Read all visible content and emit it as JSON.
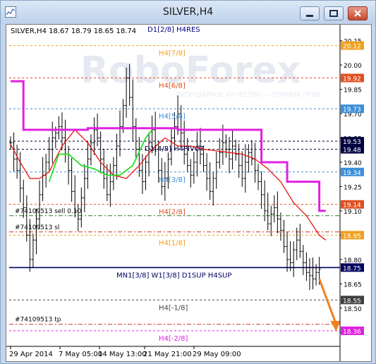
{
  "window": {
    "title": "SILVER,H4",
    "buttons": [
      "minimize",
      "restore",
      "close"
    ],
    "icon": "chart-window-icon"
  },
  "chart_data": {
    "type": "candlestick",
    "symbol_info": "SILVER,H4  18.67 18.79 18.65 18.74",
    "watermark": "RoboForex",
    "watermark_tagline": "ЛЕГЕНДАРНОЕ КАЧЕСТВО — ПОЛНЫЙ ПРИВ",
    "ylim": [
      18.29,
      20.24
    ],
    "price_ticks": [
      "20.15",
      "20.00",
      "19.85",
      "19.70",
      "19.55",
      "19.40",
      "19.25",
      "19.10",
      "18.95",
      "18.80",
      "18.65",
      "18.50",
      "18.35"
    ],
    "price_tick_values": [
      20.15,
      20.0,
      19.85,
      19.7,
      19.55,
      19.4,
      19.25,
      19.1,
      18.95,
      18.8,
      18.65,
      18.5,
      18.35
    ],
    "time_ticks": [
      "29 Apr 2014",
      "7 May 05:00",
      "14 May 13:00",
      "21 May 21:00",
      "29 May 09:00"
    ],
    "levels": [
      {
        "name": "D1[2/8] H4RES",
        "price": 20.25,
        "color": "#000080",
        "style": "none",
        "badge": ""
      },
      {
        "name": "H4[7/8]",
        "price": 20.12,
        "color": "#f0a020",
        "style": "dash",
        "badge": "20.12"
      },
      {
        "name": "H4[6/8]",
        "price": 19.92,
        "color": "#e05020",
        "style": "dash",
        "badge": "19.92"
      },
      {
        "name": "H4[5/8]",
        "price": 19.73,
        "color": "#3c8fd8",
        "style": "dash",
        "badge": "19.73"
      },
      {
        "name": "D1[4/8] H4PIVOT",
        "price": 19.53,
        "color": "#000040",
        "style": "dash",
        "badge": "19.53"
      },
      {
        "name": "",
        "price": 19.48,
        "color": "#000040",
        "style": "dash",
        "badge": "19.48"
      },
      {
        "name": "H4[3/8]",
        "price": 19.34,
        "color": "#3c8fd8",
        "style": "dash",
        "badge": "19.34"
      },
      {
        "name": "H4[2/8]",
        "price": 19.14,
        "color": "#e05020",
        "style": "dash",
        "badge": "19.14"
      },
      {
        "name": "H4[1/8]",
        "price": 18.95,
        "color": "#f0a020",
        "style": "dash",
        "badge": "18.95"
      },
      {
        "name": "MN1[3/8] W1[3/8] D1SUP H4SUP",
        "price": 18.75,
        "color": "#000060",
        "style": "solid",
        "badge": "18.75"
      },
      {
        "name": "H4[-1/8]",
        "price": 18.55,
        "color": "#444444",
        "style": "dash",
        "badge": "18.55"
      },
      {
        "name": "H4[-2/8]",
        "price": 18.36,
        "color": "#e020e0",
        "style": "dash",
        "badge": "18.36"
      }
    ],
    "orders": [
      {
        "label": "#74109513 sell 0.10",
        "price": 19.07,
        "color": "#208020"
      },
      {
        "label": "#74109513 sl",
        "price": 18.97,
        "color": "#d03020"
      },
      {
        "label": "#74109513 tp",
        "price": 18.4,
        "color": "#d03020"
      }
    ],
    "badge_colors": {
      "20.12": "#f0a020",
      "19.92": "#e05020",
      "19.73": "#3c8fd8",
      "19.53": "#000040",
      "19.48": "#000040",
      "19.34": "#3c8fd8",
      "19.14": "#e05020",
      "18.95": "#f0a020",
      "18.75": "#000060",
      "18.55": "#404040",
      "18.36": "#e020e0"
    },
    "magenta_line": [
      [
        0,
        19.9
      ],
      [
        4,
        19.9
      ],
      [
        4,
        19.6
      ],
      [
        24,
        19.6
      ],
      [
        24,
        19.61
      ],
      [
        52,
        19.61
      ],
      [
        52,
        19.6
      ],
      [
        78,
        19.6
      ],
      [
        78,
        19.4
      ],
      [
        86,
        19.4
      ],
      [
        86,
        19.28
      ],
      [
        96,
        19.28
      ],
      [
        96,
        19.1
      ],
      [
        98,
        19.1
      ]
    ],
    "green_line": [
      [
        12,
        19.28
      ],
      [
        15,
        19.45
      ],
      [
        18,
        19.45
      ],
      [
        22,
        19.38
      ],
      [
        26,
        19.36
      ],
      [
        30,
        19.32
      ],
      [
        34,
        19.32
      ],
      [
        38,
        19.38
      ],
      [
        42,
        19.55
      ],
      [
        44,
        19.6
      ]
    ],
    "red_line": [
      [
        0,
        19.51
      ],
      [
        3,
        19.4
      ],
      [
        6,
        19.3
      ],
      [
        9,
        19.3
      ],
      [
        12,
        19.34
      ],
      [
        16,
        19.5
      ],
      [
        20,
        19.6
      ],
      [
        24,
        19.52
      ],
      [
        28,
        19.4
      ],
      [
        32,
        19.32
      ],
      [
        36,
        19.3
      ],
      [
        40,
        19.38
      ],
      [
        44,
        19.48
      ],
      [
        48,
        19.55
      ],
      [
        52,
        19.5
      ],
      [
        56,
        19.5
      ],
      [
        60,
        19.48
      ],
      [
        64,
        19.47
      ],
      [
        68,
        19.46
      ],
      [
        72,
        19.45
      ],
      [
        76,
        19.42
      ],
      [
        80,
        19.36
      ],
      [
        84,
        19.28
      ],
      [
        88,
        19.15
      ],
      [
        92,
        19.07
      ],
      [
        96,
        18.95
      ],
      [
        98,
        18.92
      ]
    ],
    "closes": [
      19.52,
      19.42,
      19.35,
      19.24,
      19.12,
      18.95,
      18.8,
      18.92,
      19.05,
      19.2,
      19.32,
      19.4,
      19.48,
      19.55,
      19.58,
      19.62,
      19.55,
      19.45,
      19.35,
      19.22,
      19.1,
      19.05,
      19.18,
      19.3,
      19.42,
      19.52,
      19.6,
      19.55,
      19.42,
      19.3,
      19.2,
      19.28,
      19.38,
      19.5,
      19.62,
      19.75,
      19.92,
      19.8,
      19.62,
      19.48,
      19.35,
      19.28,
      19.4,
      19.52,
      19.6,
      19.48,
      19.35,
      19.25,
      19.3,
      19.42,
      19.55,
      19.62,
      19.7,
      19.58,
      19.45,
      19.38,
      19.32,
      19.4,
      19.5,
      19.45,
      19.38,
      19.3,
      19.22,
      19.3,
      19.4,
      19.46,
      19.52,
      19.48,
      19.42,
      19.5,
      19.45,
      19.38,
      19.3,
      19.4,
      19.46,
      19.42,
      19.35,
      19.28,
      19.2,
      19.1,
      19.02,
      19.08,
      19.12,
      19.05,
      18.98,
      18.88,
      18.8,
      18.78,
      18.86,
      18.92,
      18.85,
      18.78,
      18.72,
      18.7,
      18.68,
      18.72,
      18.74
    ],
    "forecast_arrow": {
      "from": [
        96,
        18.68
      ],
      "to": [
        101,
        18.36
      ],
      "color": "#f08020"
    }
  }
}
